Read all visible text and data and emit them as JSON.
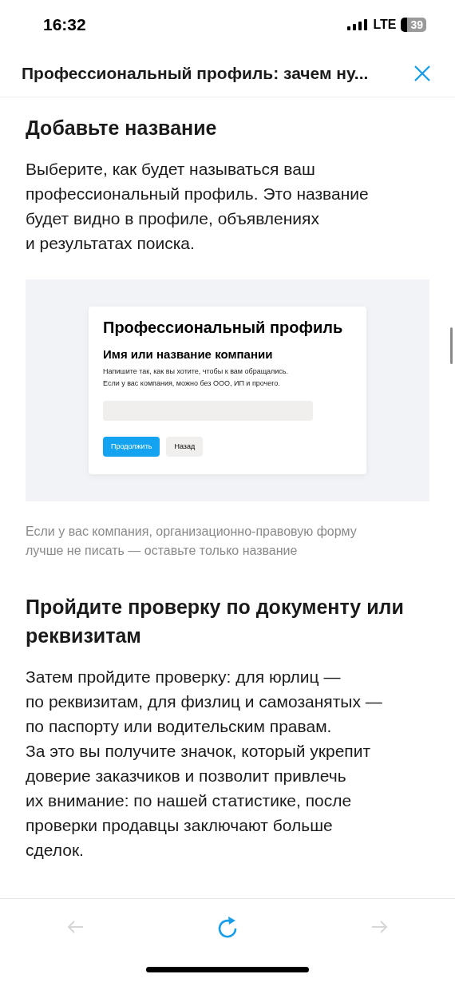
{
  "status_bar": {
    "time": "16:32",
    "network": "LTE",
    "battery": "39"
  },
  "header": {
    "title": "Профессиональный профиль: зачем ну..."
  },
  "sections": [
    {
      "kind": "text",
      "heading": "Добавьте название",
      "body": "Выберите, как будет называться ваш\nпрофессиональный профиль. Это название\nбудет видно в профиле, объявлениях\nи результатах поиска."
    },
    {
      "kind": "figure",
      "card_title": "Профессиональный профиль",
      "card_subtitle": "Имя или название компании",
      "card_hint": "Напишите так, как вы хотите, чтобы к вам обращались.\nЕсли у вас компания, можно без ООО, ИП и прочего.",
      "buttons": [
        {
          "label": "Продолжить",
          "kind": "primary"
        },
        {
          "label": "Назад",
          "kind": "secondary"
        }
      ],
      "caption": "Если у вас компания, организационно-правовую форму\nлучше не писать — оставьте только название"
    },
    {
      "kind": "text",
      "heading": "Пройдите проверку по документу или реквизитам",
      "body": "Затем пройдите проверку: для юрлиц —\nпо реквизитам, для физлиц и самозанятых —\nпо паспорту или водительским правам.\nЗа это вы получите значок, который укрепит\nдоверие заказчиков и позволит привлечь\nих внимание: по нашей статистике, после\nпроверки продавцы заключают больше\nсделок."
    }
  ],
  "toolbar": [
    {
      "kind": "back",
      "disabled": true
    },
    {
      "kind": "reload",
      "disabled": false
    },
    {
      "kind": "forward",
      "disabled": true
    }
  ]
}
